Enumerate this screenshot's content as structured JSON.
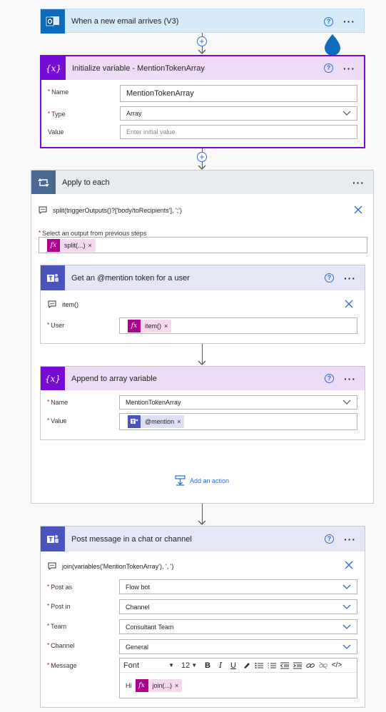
{
  "trigger": {
    "title": "When a new email arrives (V3)"
  },
  "init_var": {
    "title": "Initialize variable - MentionTokenArray",
    "name_label": "Name",
    "name_value": "MentionTokenArray",
    "type_label": "Type",
    "type_value": "Array",
    "value_label": "Value",
    "value_placeholder": "Enter initial value"
  },
  "apply_each": {
    "title": "Apply to each",
    "expression": "split(triggerOutputs()?['body/toRecipients'], ';')",
    "select_label": "Select an output from previous steps",
    "token": "split(...)"
  },
  "mention": {
    "title": "Get an @mention token for a user",
    "expression": "item()",
    "user_label": "User",
    "token": "item()"
  },
  "append": {
    "title": "Append to array variable",
    "name_label": "Name",
    "name_value": "MentionTokenArray",
    "value_label": "Value",
    "token": "@mention"
  },
  "add_action": {
    "label": "Add an action"
  },
  "post": {
    "title": "Post message in a chat or channel",
    "expression": "join(variables('MentionTokenArray'), ', ')",
    "post_as_label": "Post as",
    "post_as_value": "Flow bot",
    "post_in_label": "Post in",
    "post_in_value": "Channel",
    "team_label": "Team",
    "team_value": "Consultant Team",
    "channel_label": "Channel",
    "channel_value": "General",
    "message_label": "Message",
    "font_label": "Font",
    "font_size": "12",
    "message_text": "Hi",
    "token": "join(...)"
  },
  "colors": {
    "outlook_blue": "#0f6cbd",
    "variable_purple": "#770bd6",
    "loop_slate": "#486991",
    "teams_indigo": "#4b53bc",
    "expr_magenta": "#ad008c",
    "link_blue": "#2c6bd6"
  }
}
